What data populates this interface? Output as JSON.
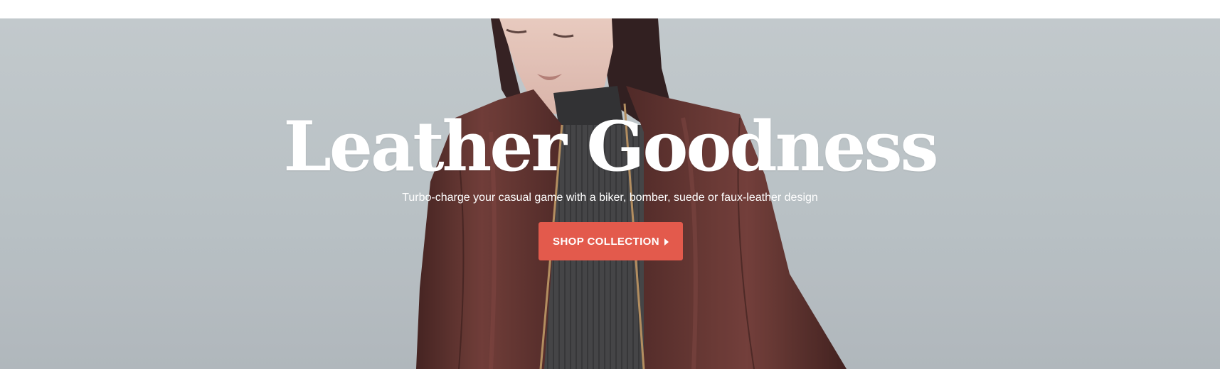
{
  "hero": {
    "title": "Leather Goodness",
    "subtitle": "Turbo-charge your casual game with a biker, bomber, suede or faux-leather design",
    "cta_label": "SHOP COLLECTION",
    "cta_icon": "caret-right-icon",
    "image_subject": "model-wearing-burgundy-leather-jacket"
  },
  "colors": {
    "background": "#bcc3c6",
    "cta": "#e35a4c",
    "text": "#ffffff",
    "jacket": "#5a2c28",
    "sweater": "#3d3d3f"
  }
}
